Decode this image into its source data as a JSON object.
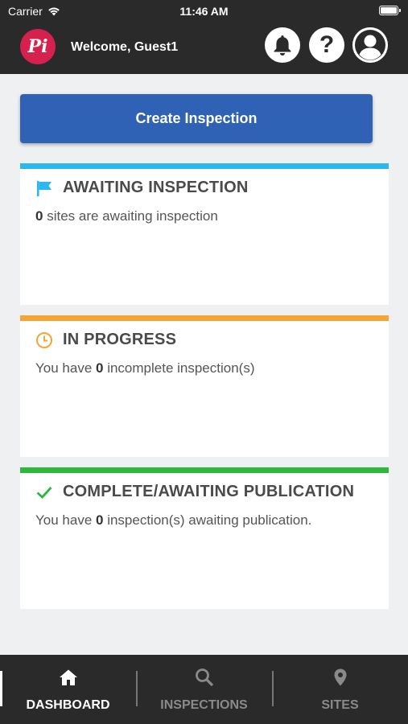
{
  "status_bar": {
    "carrier": "Carrier",
    "time": "11:46 AM"
  },
  "header": {
    "logo_text": "Pi",
    "welcome": "Welcome, Guest1",
    "help_glyph": "?"
  },
  "create_button": {
    "label": "Create Inspection",
    "color": "#2f62b4"
  },
  "cards": [
    {
      "title": "AWAITING INSPECTION",
      "icon": "flag-icon",
      "accent": "#2bb8ee",
      "count": "0",
      "text_before": "",
      "text_after": " sites are awaiting inspection"
    },
    {
      "title": "IN PROGRESS",
      "icon": "clock-icon",
      "accent": "#f4a536",
      "count": "0",
      "text_before": "You have ",
      "text_after": " incomplete inspection(s)"
    },
    {
      "title": "COMPLETE/AWAITING PUBLICATION",
      "icon": "checkmark-icon",
      "accent": "#2eb83a",
      "count": "0",
      "text_before": "You have ",
      "text_after": " inspection(s) awaiting publication."
    }
  ],
  "bottom_nav": {
    "items": [
      {
        "label": "DASHBOARD",
        "icon": "home-icon",
        "active": true
      },
      {
        "label": "INSPECTIONS",
        "icon": "search-icon",
        "active": false
      },
      {
        "label": "SITES",
        "icon": "location-pin-icon",
        "active": false
      }
    ]
  }
}
